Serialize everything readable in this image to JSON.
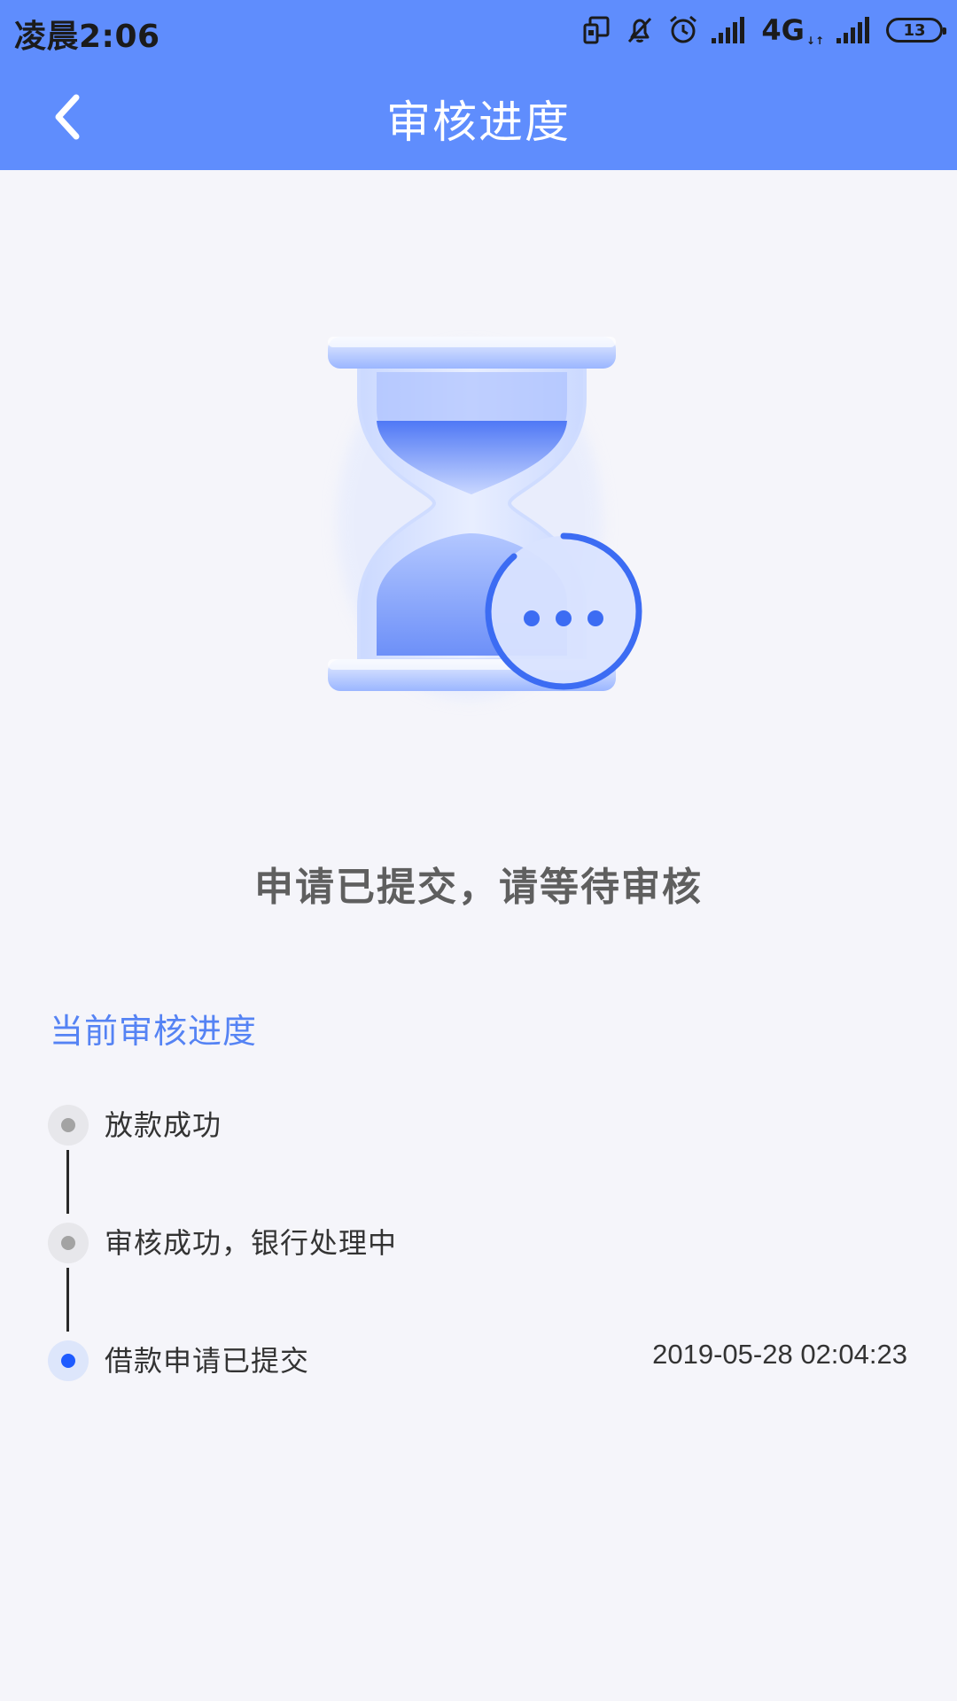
{
  "status_bar": {
    "time": "凌晨2:06",
    "network": "4G",
    "network_arrows": "↓↑",
    "battery": "13"
  },
  "header": {
    "title": "审核进度"
  },
  "main": {
    "message": "申请已提交，请等待审核",
    "section_title": "当前审核进度",
    "timeline": [
      {
        "label": "放款成功",
        "time": "",
        "active": false
      },
      {
        "label": "审核成功，银行处理中",
        "time": "",
        "active": false
      },
      {
        "label": "借款申请已提交",
        "time": "2019-05-28 02:04:23",
        "active": true
      }
    ]
  },
  "colors": {
    "header_bg": "#5f8dfd",
    "accent": "#5583f4",
    "active_dot": "#1e5bff",
    "inactive_dot": "#a3a3a3",
    "page_bg": "#f5f5fa"
  },
  "icons": {
    "illustration": "hourglass-chat-icon",
    "back": "chevron-left-icon"
  }
}
